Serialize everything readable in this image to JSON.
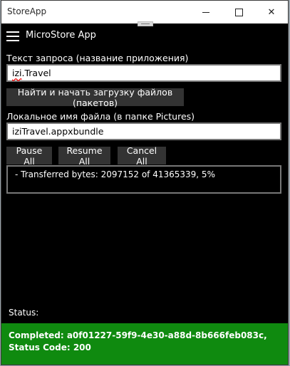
{
  "window": {
    "title": "StoreApp",
    "controls": {
      "minimize": "minimize",
      "maximize": "maximize",
      "close": "✕"
    }
  },
  "header": {
    "app_name": "MicroStore App"
  },
  "query": {
    "label": "Текст запроса (название приложения)",
    "value_prefix": "izi",
    "value_suffix": ".Travel"
  },
  "find_button": "Найти и начать загрузку файлов (пакетов)",
  "filename": {
    "label": "Локальное имя файла (в папке Pictures)",
    "value": "iziTravel.appxbundle"
  },
  "buttons": {
    "pause": "Pause All",
    "resume": "Resume All",
    "cancel": "Cancel All"
  },
  "output": {
    "text": "- Transferred bytes: 2097152 of 41365339, 5%"
  },
  "status": {
    "label": "Status:",
    "message": "Completed: a0f01227-59f9-4e30-a88d-8b666feb083c, Status Code: 200"
  },
  "colors": {
    "status_bar": "#0f8a0f",
    "background": "#000000",
    "button": "#333333"
  }
}
